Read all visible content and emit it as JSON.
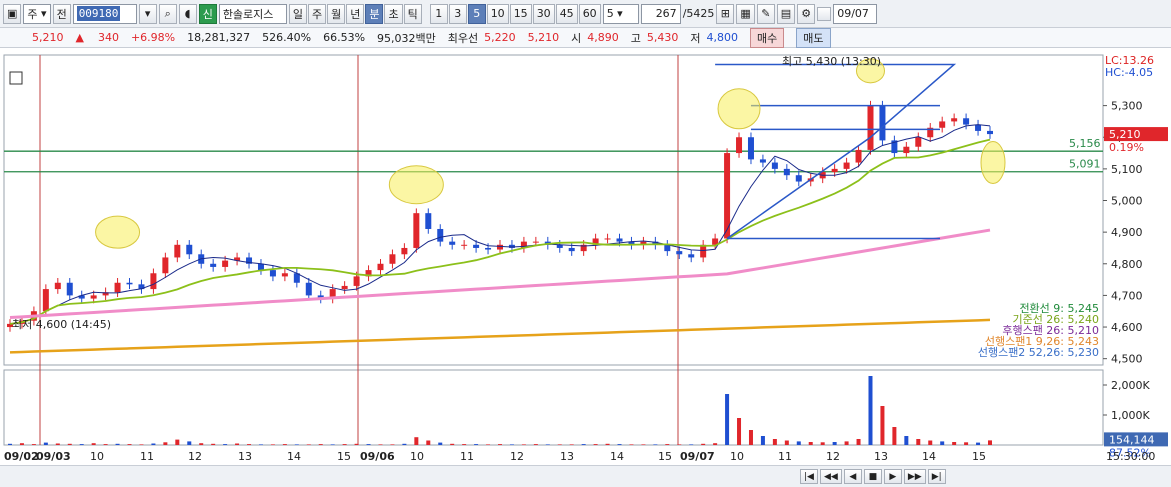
{
  "toolbar": {
    "market": "주",
    "prev": "전",
    "code": "009180",
    "sin_label": "신",
    "stock_name": "한솔로지스",
    "periods": [
      "일",
      "주",
      "월",
      "년",
      "분",
      "초",
      "틱"
    ],
    "active_period": "분",
    "intervals": [
      "1",
      "3",
      "5",
      "10",
      "15",
      "30",
      "45",
      "60"
    ],
    "active_interval": "5",
    "interval_select": "5",
    "count": "267",
    "count_total": "/5425",
    "date_value": "09/07"
  },
  "infobar": {
    "price": "5,210",
    "change_arrow": "▲",
    "change": "340",
    "change_pct": "+6.98%",
    "volume": "18,281,327",
    "vol_ratio": "526.40%",
    "pct2": "66.53%",
    "amount": "95,032백만",
    "best_ask_label": "최우선",
    "best_ask": "5,220",
    "best_bid": "5,210",
    "open_label": "시",
    "open": "4,890",
    "high_label": "고",
    "high": "5,430",
    "low_label": "저",
    "low": "4,800",
    "buy_label": "매수",
    "sell_label": "매도"
  },
  "chart_data": {
    "type": "candlestick",
    "interval": "5분",
    "lc_label": "LC:13.26",
    "hc_label": "HC:-4.05",
    "price_ticks": [
      "5,300",
      "5,200",
      "5,100",
      "5,000",
      "4,900",
      "4,800",
      "4,700",
      "4,600",
      "4,500"
    ],
    "volume_ticks": [
      "2,000K",
      "1,000K"
    ],
    "current_price_tag": "5,210",
    "current_pct_tag": "0.19%",
    "volume_tag": "154,144",
    "volume_pct_tag": "87.52%",
    "hlines": [
      {
        "value": 5156,
        "label": "5,156"
      },
      {
        "value": 5091,
        "label": "5,091"
      }
    ],
    "high_annotation": "최고 5,430 (13:30)",
    "low_annotation": "최저 4,600 (14:45)",
    "ichimoku_legend": [
      {
        "name": "전환선 9: 5,245",
        "color": "#1f8a3a"
      },
      {
        "name": "기준선 26: 5,240",
        "color": "#7aa51a"
      },
      {
        "name": "후행스팬 26: 5,210",
        "color": "#7b2a98"
      },
      {
        "name": "선행스팬1 9,26: 5,243",
        "color": "#e0862b"
      },
      {
        "name": "선행스팬2 52,26: 5,230",
        "color": "#3a6fc8"
      }
    ],
    "x_labels": [
      "09/02",
      "09/03",
      "10",
      "11",
      "12",
      "13",
      "14",
      "15",
      "09/06",
      "10",
      "11",
      "12",
      "13",
      "14",
      "15",
      "09/07",
      "10",
      "11",
      "12",
      "13",
      "14",
      "15",
      "15:30:00"
    ],
    "close": [
      4610,
      4620,
      4650,
      4720,
      4740,
      4700,
      4690,
      4700,
      4710,
      4740,
      4735,
      4720,
      4770,
      4820,
      4860,
      4830,
      4800,
      4790,
      4810,
      4820,
      4800,
      4780,
      4760,
      4770,
      4740,
      4700,
      4690,
      4720,
      4730,
      4760,
      4780,
      4800,
      4830,
      4850,
      4960,
      4910,
      4870,
      4860,
      4860,
      4850,
      4845,
      4860,
      4850,
      4870,
      4870,
      4860,
      4850,
      4840,
      4860,
      4880,
      4880,
      4870,
      4860,
      4870,
      4860,
      4840,
      4830,
      4820,
      4860,
      4880,
      5150,
      5200,
      5130,
      5120,
      5100,
      5080,
      5060,
      5070,
      5090,
      5100,
      5120,
      5160,
      5300,
      5190,
      5150,
      5170,
      5200,
      5230,
      5250,
      5260,
      5240,
      5220,
      5210
    ],
    "ylim": [
      4480,
      5460
    ],
    "volume": [
      40,
      60,
      30,
      80,
      50,
      40,
      30,
      60,
      30,
      40,
      30,
      20,
      50,
      90,
      180,
      120,
      60,
      40,
      30,
      50,
      30,
      20,
      20,
      30,
      20,
      20,
      30,
      20,
      30,
      40,
      30,
      20,
      20,
      40,
      260,
      150,
      80,
      40,
      30,
      30,
      20,
      30,
      20,
      20,
      30,
      20,
      20,
      20,
      30,
      30,
      40,
      30,
      20,
      20,
      20,
      30,
      20,
      20,
      40,
      60,
      1700,
      900,
      500,
      300,
      200,
      150,
      120,
      100,
      90,
      100,
      120,
      200,
      2300,
      1300,
      600,
      300,
      200,
      150,
      120,
      100,
      90,
      80,
      154
    ]
  },
  "scrollbar": {
    "nav_labels": [
      "|◀",
      "◀◀",
      "◀",
      "■",
      "▶",
      "▶▶",
      "▶|"
    ]
  }
}
